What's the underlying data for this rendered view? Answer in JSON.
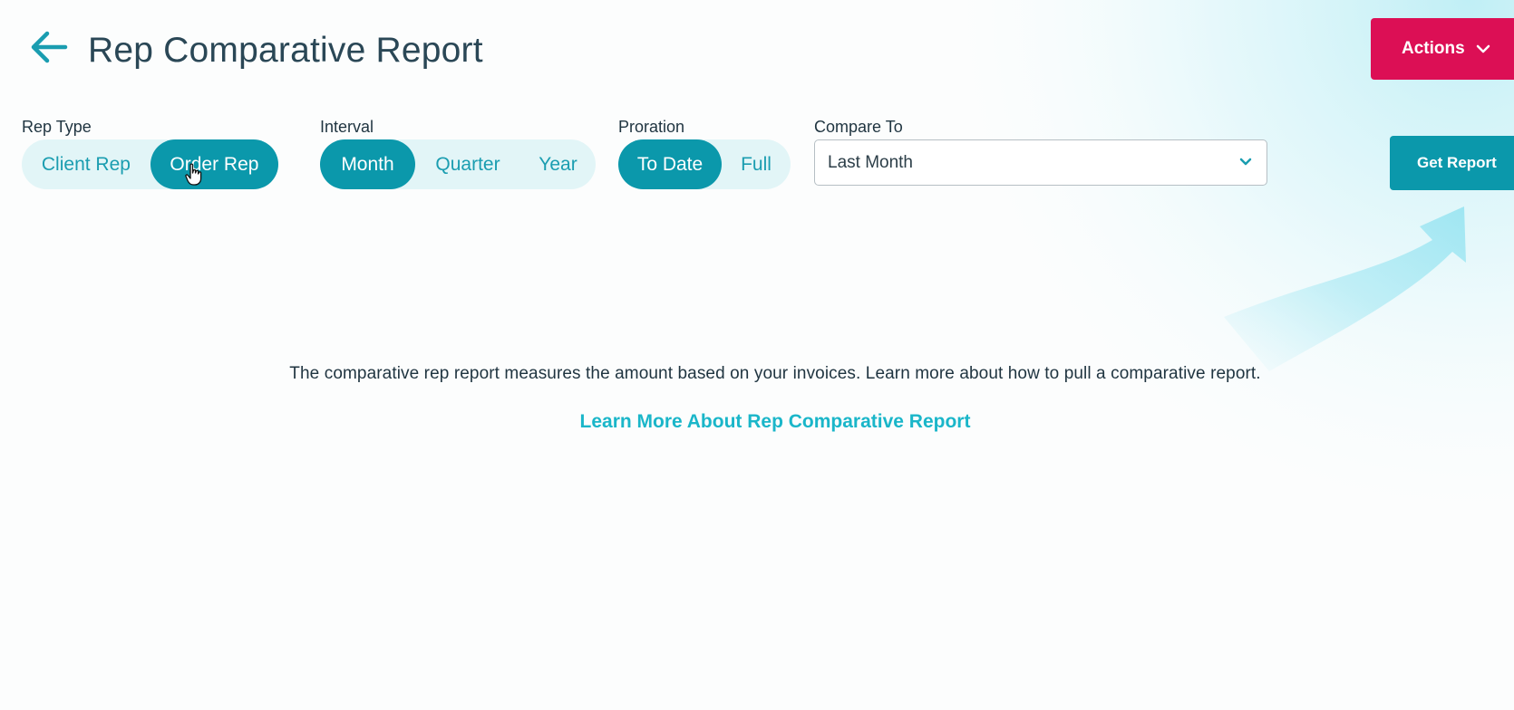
{
  "header": {
    "title": "Rep Comparative Report",
    "back_icon": "arrow-left-icon",
    "actions_label": "Actions",
    "actions_icon": "chevron-down-icon"
  },
  "filters": {
    "rep_type": {
      "label": "Rep Type",
      "options": [
        "Client Rep",
        "Order Rep"
      ],
      "selected": "Order Rep"
    },
    "interval": {
      "label": "Interval",
      "options": [
        "Month",
        "Quarter",
        "Year"
      ],
      "selected": "Month"
    },
    "proration": {
      "label": "Proration",
      "options": [
        "To Date",
        "Full"
      ],
      "selected": "To Date"
    },
    "compare_to": {
      "label": "Compare To",
      "value": "Last Month"
    }
  },
  "get_report_label": "Get Report",
  "info": {
    "text": "The comparative rep report measures the amount based on your invoices. Learn more about how to pull a comparative report.",
    "link": "Learn More About Rep Comparative Report"
  },
  "colors": {
    "accent": "#0b98ab",
    "actions": "#dc0f55",
    "link": "#1ab6c9",
    "segment_bg": "#e2f5f7"
  }
}
